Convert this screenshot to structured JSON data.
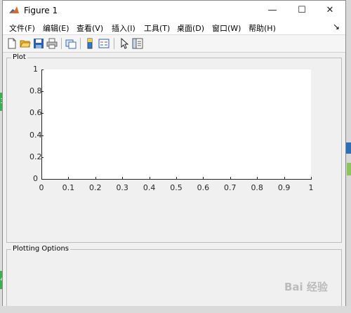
{
  "window": {
    "title": "Figure 1",
    "minimize": "—",
    "maximize": "☐",
    "close": "✕"
  },
  "menu": [
    "文件(F)",
    "编辑(E)",
    "查看(V)",
    "插入(I)",
    "工具(T)",
    "桌面(D)",
    "窗口(W)",
    "帮助(H)"
  ],
  "menu_overflow": "↘",
  "toolbar": [
    "new-figure-icon",
    "open-file-icon",
    "save-icon",
    "print-icon",
    "link-figure-icon",
    "colorbar-icon",
    "legend-icon",
    "pointer-icon",
    "property-inspector-icon"
  ],
  "panels": {
    "plot_label": "Plot",
    "options_label": "Plotting Options"
  },
  "chart_data": {
    "type": "line",
    "x": [],
    "series": [],
    "xlim": [
      0,
      1
    ],
    "ylim": [
      0,
      1
    ],
    "xticks": [
      "0",
      "0.1",
      "0.2",
      "0.3",
      "0.4",
      "0.5",
      "0.6",
      "0.7",
      "0.8",
      "0.9",
      "1"
    ],
    "yticks": [
      "0",
      "0.2",
      "0.4",
      "0.6",
      "0.8",
      "1"
    ],
    "grid": false
  },
  "background": {
    "tab_top": "3",
    "tab_bottom": "4"
  },
  "watermark": "Bai 经验"
}
